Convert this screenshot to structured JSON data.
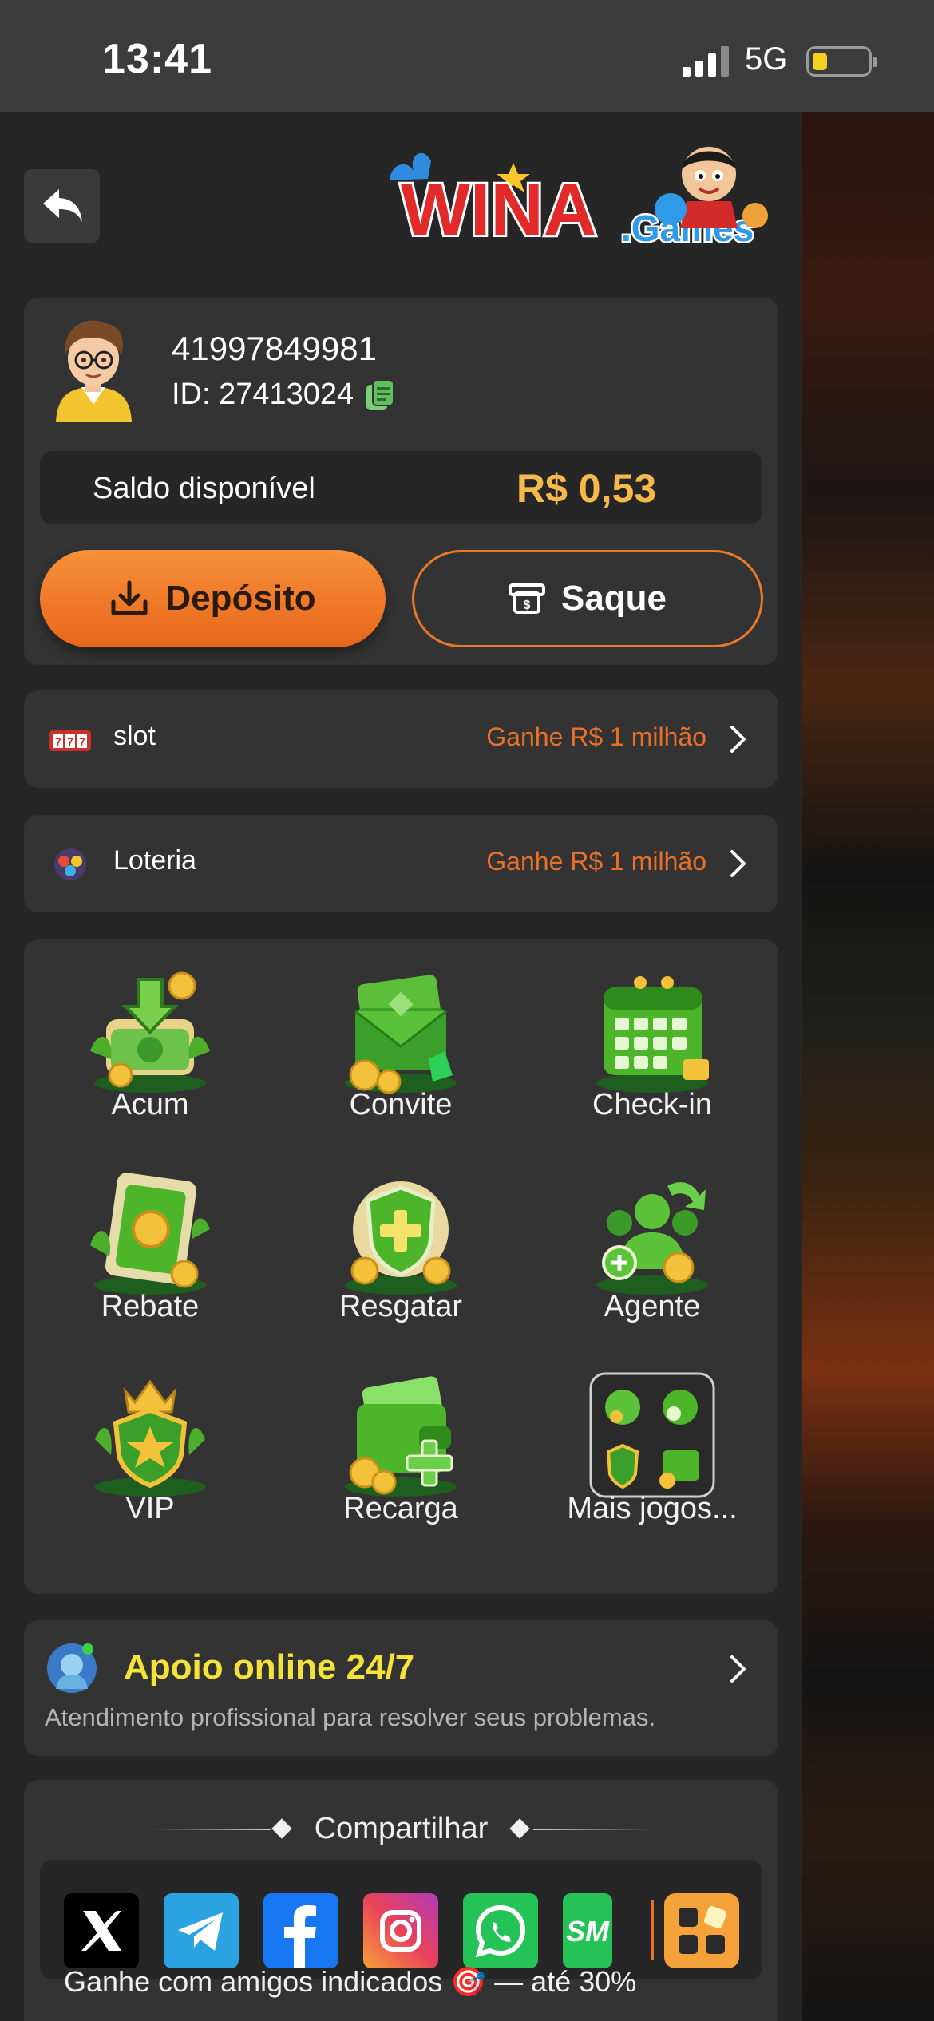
{
  "status": {
    "time": "13:41",
    "network": "5G"
  },
  "brand": {
    "logo_text": "WINA.Games"
  },
  "user": {
    "phone": "41997849981",
    "id_text": "ID: 27413024",
    "balance_label": "Saldo disponível",
    "balance_value": "R$ 0,53"
  },
  "actions": {
    "deposit_label": "Depósito",
    "withdraw_label": "Saque"
  },
  "promos": [
    {
      "label": "slot",
      "cta": "Ganhe R$ 1 milhão"
    },
    {
      "label": "Loteria",
      "cta": "Ganhe R$ 1 milhão"
    }
  ],
  "features": [
    {
      "label": "Acum",
      "icon": "money-stack-icon"
    },
    {
      "label": "Convite",
      "icon": "invite-envelope-icon"
    },
    {
      "label": "Check-in",
      "icon": "calendar-icon"
    },
    {
      "label": "Rebate",
      "icon": "rebate-ticket-icon"
    },
    {
      "label": "Resgatar",
      "icon": "shield-plus-icon"
    },
    {
      "label": "Agente",
      "icon": "agent-people-icon"
    },
    {
      "label": "VIP",
      "icon": "vip-crown-shield-icon"
    },
    {
      "label": "Recarga",
      "icon": "wallet-plus-icon"
    },
    {
      "label": "Mais jogos...",
      "icon": "more-games-icon"
    }
  ],
  "support": {
    "title": "Apoio online 24/7",
    "subtitle": "Atendimento profissional para resolver seus problemas."
  },
  "share": {
    "title": "Compartilhar",
    "caption": "Ganhe com amigos indicados  🎯 — até 30%",
    "platforms": [
      "x-icon",
      "telegram-icon",
      "facebook-icon",
      "instagram-icon",
      "whatsapp-icon",
      "sms-icon",
      "more-apps-icon"
    ]
  },
  "colors": {
    "accent_orange": "#e8712a",
    "balance_gold": "#f5b94c",
    "support_yellow": "#f5e33a",
    "panel": "#262626",
    "card": "#333333"
  }
}
